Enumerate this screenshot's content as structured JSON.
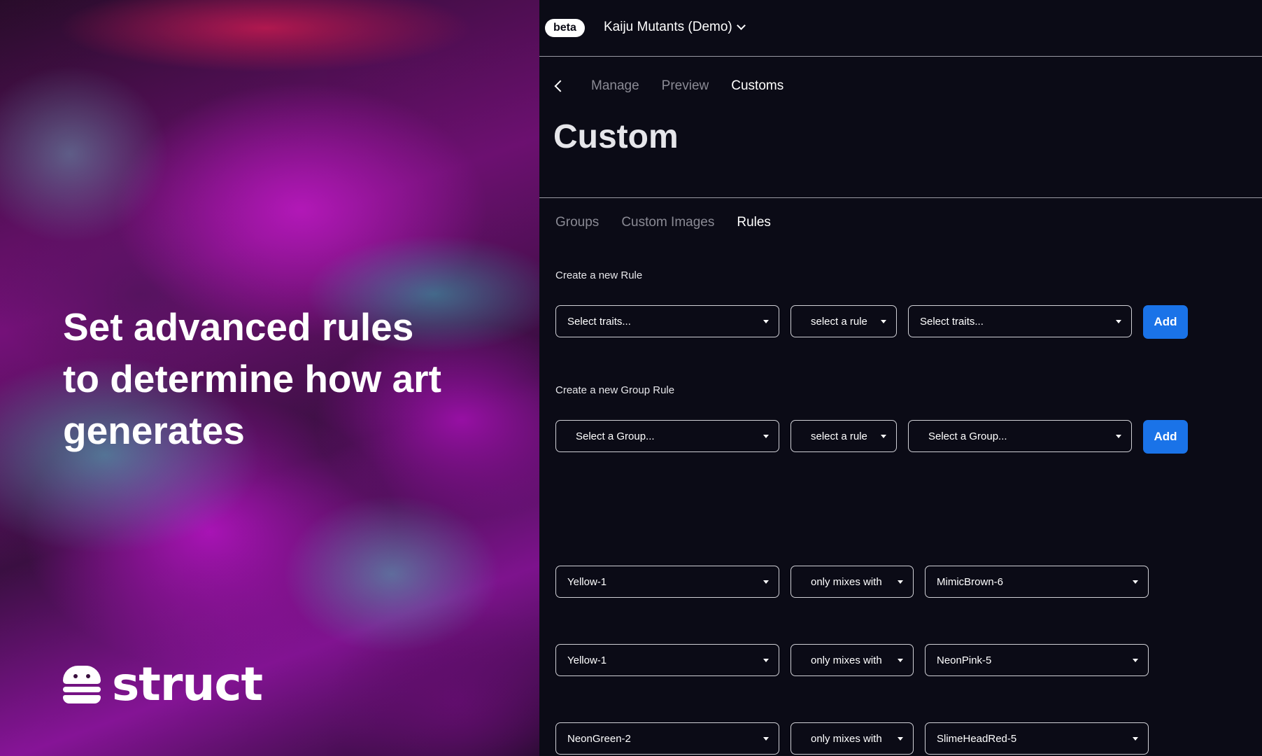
{
  "hero": {
    "headline": "Set advanced rules to determine how art generates",
    "brand_name": "struct"
  },
  "topbar": {
    "badge": "beta",
    "project_name": "Kaiju Mutants (Demo)"
  },
  "nav": {
    "tabs": [
      {
        "label": "Manage",
        "active": false
      },
      {
        "label": "Preview",
        "active": false
      },
      {
        "label": "Customs",
        "active": true
      }
    ]
  },
  "page_title": "Custom",
  "sub_tabs": [
    {
      "label": "Groups",
      "active": false
    },
    {
      "label": "Custom Images",
      "active": false
    },
    {
      "label": "Rules",
      "active": true
    }
  ],
  "new_rule": {
    "label": "Create a new Rule",
    "left_placeholder": "Select traits...",
    "rule_placeholder": "select a rule",
    "right_placeholder": "Select traits...",
    "add_label": "Add"
  },
  "new_group_rule": {
    "label": "Create a new Group Rule",
    "left_placeholder": "Select a Group...",
    "rule_placeholder": "select a rule",
    "right_placeholder": "Select a Group...",
    "add_label": "Add"
  },
  "rules": [
    {
      "left": "Yellow-1",
      "rule": "only mixes with",
      "right": "MimicBrown-6"
    },
    {
      "left": "Yellow-1",
      "rule": "only mixes with",
      "right": "NeonPink-5"
    },
    {
      "left": "NeonGreen-2",
      "rule": "only mixes with",
      "right": "SlimeHeadRed-5"
    }
  ],
  "colors": {
    "accent": "#1a73e8",
    "background": "#0b0b16",
    "text": "#ffffff",
    "muted_text": "#8a8a94"
  }
}
